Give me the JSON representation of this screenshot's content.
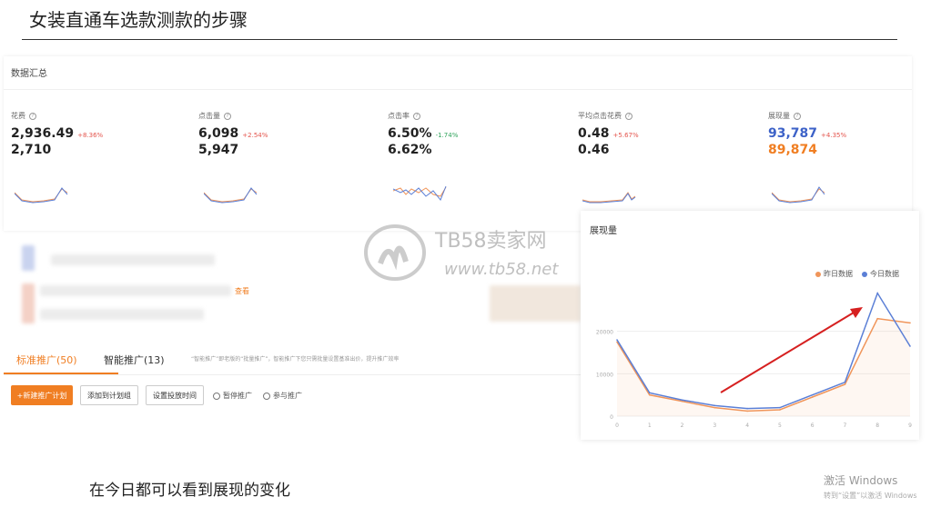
{
  "slide": {
    "title": "女装直通车选款测款的步骤",
    "caption": "在今日都可以看到展现的变化"
  },
  "panel": {
    "title": "数据汇总",
    "metrics": [
      {
        "name": "花费",
        "today": "2,936.49",
        "change": "+8.36%",
        "direction": "up",
        "yesterday": "2,710"
      },
      {
        "name": "点击量",
        "today": "6,098",
        "change": "+2.54%",
        "direction": "up",
        "yesterday": "5,947"
      },
      {
        "name": "点击率",
        "today": "6.50%",
        "change": "-1.74%",
        "direction": "down",
        "yesterday": "6.62%"
      },
      {
        "name": "平均点击花费",
        "today": "0.48",
        "change": "+5.67%",
        "direction": "up",
        "yesterday": "0.46"
      },
      {
        "name": "展现量",
        "today": "93,787",
        "change": "+4.35%",
        "direction": "up",
        "yesterday": "89,874"
      }
    ]
  },
  "blurred": {
    "link_text": "查看"
  },
  "tabs": {
    "items": [
      {
        "label": "标准推广(50)",
        "active": true
      },
      {
        "label": "智能推广(13)",
        "active": false
      }
    ],
    "note": "“智能推广”即老版的“批量推广”，智能推广下您只需批量设置基准出价，提升推广效率",
    "buttons": {
      "new_plan": "+新建推广计划",
      "add_group": "添加到计划组",
      "set_time": "设置投放时间",
      "pause": "暂停推广",
      "join": "参与推广"
    }
  },
  "watermark": {
    "brand": "TB58卖家网",
    "url": "www.tb58.net"
  },
  "chart": {
    "title": "展现量",
    "legend": [
      "昨日数据",
      "今日数据"
    ],
    "colors": {
      "yesterday": "#f0955a",
      "today": "#5b7fd6",
      "arrow": "#d62020"
    }
  },
  "chart_data": {
    "type": "line",
    "title": "展现量",
    "x": [
      0,
      1,
      2,
      3,
      4,
      5,
      6,
      7,
      8,
      9
    ],
    "series": [
      {
        "name": "昨日数据",
        "values": [
          17500,
          5000,
          3500,
          2000,
          1200,
          1500,
          4500,
          7500,
          23000,
          22000
        ]
      },
      {
        "name": "今日数据",
        "values": [
          18000,
          5500,
          3800,
          2500,
          1800,
          2000,
          5000,
          8000,
          29000,
          16500
        ]
      }
    ],
    "ylim": [
      0,
      30000
    ],
    "yticks": [
      "0",
      "10000",
      "20000"
    ],
    "legend_position": "top-right",
    "grid": true
  },
  "windows": {
    "activate": "激活 Windows",
    "activate_hint": "转到“设置”以激活 Windows"
  }
}
